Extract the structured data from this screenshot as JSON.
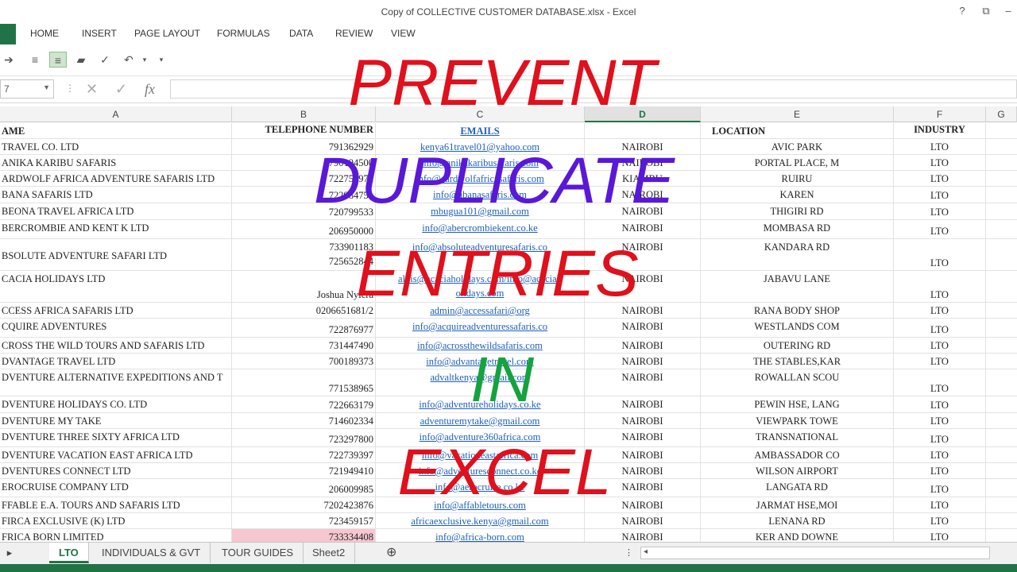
{
  "window": {
    "title": "Copy of COLLECTIVE CUSTOMER DATABASE.xlsx - Excel",
    "help_glyph": "?",
    "restore_glyph": "⧉"
  },
  "ribbon": {
    "tabs": [
      "HOME",
      "INSERT",
      "PAGE LAYOUT",
      "FORMULAS",
      "DATA",
      "REVIEW",
      "VIEW"
    ]
  },
  "formula_bar": {
    "name_box": "7",
    "fx_label": "fx",
    "content": ""
  },
  "columns": [
    "A",
    "B",
    "C",
    "D",
    "E",
    "F",
    "G"
  ],
  "selected_column": "D",
  "header_row": {
    "name": "AME",
    "phone": "TELEPHONE NUMBER",
    "email": "EMAILS",
    "town": "",
    "location": "LOCATION",
    "industry": "INDUSTRY"
  },
  "rows": [
    {
      "name": " TRAVEL CO. LTD",
      "phone": "791362929",
      "email": "kenya61travel01@yahoo.com",
      "town": "NAIROBI",
      "location": "AVIC PARK",
      "industry": "LTO"
    },
    {
      "name": "ANIKA KARIBU SAFARIS",
      "phone": "790194500",
      "email": "info@anikakaribusafaris.com",
      "town": "NAIROBI",
      "location": "PORTAL PLACE, M",
      "industry": "LTO"
    },
    {
      "name": "ARDWOLF AFRICA ADVENTURE SAFARIS LTD",
      "phone": "722751972",
      "email": "info@aardwolfafricasafaris.com",
      "town": "KIAMBU",
      "location": "RUIRU",
      "industry": "LTO"
    },
    {
      "name": "BANA SAFARIS LTD",
      "phone": "722984751",
      "email": "info@abanasafaris.com",
      "town": "NAIROBI",
      "location": "KAREN",
      "industry": "LTO"
    },
    {
      "name": "BEONA TRAVEL AFRICA LTD",
      "phone": "720799533",
      "email": "mbugua101@gmail.com",
      "town": "NAIROBI",
      "location": "THIGIRI RD",
      "industry": "LTO"
    },
    {
      "name": "BERCROMBIE AND KENT K LTD",
      "phone": "206950000",
      "email": "info@abercrombiekent.co.ke",
      "town": "NAIROBI",
      "location": "MOMBASA RD",
      "industry": "LTO"
    },
    {
      "name": "BSOLUTE ADVENTURE SAFARI LTD",
      "phone": "733901183",
      "phone2": "725652844",
      "email": "info@absoluteadventuresafaris.co",
      "town": "NAIROBI",
      "location": "KANDARA RD",
      "industry": "LTO"
    },
    {
      "name": "CACIA HOLIDAYS LTD",
      "phone": "Joshua Nyiera",
      "email": "alois@acaciaholidays.com/info@acaciah",
      "email2": "olidays.com",
      "town": "NAIROBI",
      "location": "JABAVU LANE",
      "industry": "LTO"
    },
    {
      "name": "CCESS AFRICA SAFARIS LTD",
      "phone": "0206651681/2",
      "email": "admin@accessafari@org",
      "town": "NAIROBI",
      "location": "RANA BODY SHOP",
      "industry": "LTO"
    },
    {
      "name": "CQUIRE ADVENTURES",
      "phone": "722876977",
      "email": "info@acquireadventuressafaris.co",
      "town": "NAIROBI",
      "location": "WESTLANDS COM",
      "industry": "LTO"
    },
    {
      "name": "CROSS THE WILD TOURS AND SAFARIS LTD",
      "phone": "731447490",
      "email": "info@acrossthewildsafaris.com",
      "town": "NAIROBI",
      "location": "OUTERING RD",
      "industry": "LTO"
    },
    {
      "name": "DVANTAGE TRAVEL LTD",
      "phone": "700189373",
      "email": "info@advantagetravel.com",
      "town": "NAIROBI",
      "location": "THE STABLES,KAR",
      "industry": "LTO"
    },
    {
      "name": "DVENTURE ALTERNATIVE EXPEDITIONS AND T",
      "phone": "771538965",
      "email": "advaltkenya@gmail.com",
      "town": "NAIROBI",
      "location": "ROWALLAN SCOU",
      "industry": "LTO"
    },
    {
      "name": "DVENTURE HOLIDAYS CO. LTD",
      "phone": "722663179",
      "email": "info@adventureholidays.co.ke",
      "town": "NAIROBI",
      "location": "PEWIN HSE, LANG",
      "industry": "LTO"
    },
    {
      "name": "DVENTURE MY TAKE",
      "phone": "714602334",
      "email": "adventuremytake@gmail.com",
      "town": "NAIROBI",
      "location": "VIEWPARK TOWE",
      "industry": "LTO"
    },
    {
      "name": "DVENTURE THREE SIXTY AFRICA LTD",
      "phone": "723297800",
      "email": "info@adventure360africa.com",
      "town": "NAIROBI",
      "location": "TRANSNATIONAL",
      "industry": "LTO"
    },
    {
      "name": "DVENTURE VACATION EAST AFRICA LTD",
      "phone": "722739397",
      "email": "info@vacationeastafrica.com",
      "town": "NAIROBI",
      "location": "AMBASSADOR CO",
      "industry": "LTO"
    },
    {
      "name": "DVENTURES CONNECT LTD",
      "phone": "721949410",
      "email": "info@adventuresconnect.co.ke",
      "town": "NAIROBI",
      "location": "WILSON AIRPORT",
      "industry": "LTO"
    },
    {
      "name": "EROCRUISE COMPANY LTD",
      "phone": "206009985",
      "email": "info@aerocruise.co.ke",
      "town": "NAIROBI",
      "location": "LANGATA RD",
      "industry": "LTO"
    },
    {
      "name": "FFABLE E.A. TOURS AND SAFARIS LTD",
      "phone": "7202423876",
      "email": "info@affabletours.com",
      "town": "NAIROBI",
      "location": "JARMAT HSE,MOI",
      "industry": "LTO"
    },
    {
      "name": "FIRCA EXCLUSIVE (K) LTD",
      "phone": "723459157",
      "email": "africaexclusive.kenya@gmail.com",
      "town": "NAIROBI",
      "location": "LENANA RD",
      "industry": "LTO"
    },
    {
      "name": "FRICA BORN LIMITED",
      "phone": "733334408",
      "email": "info@africa-born.com",
      "town": "NAIROBI",
      "location": "KER AND DOWNE",
      "industry": "LTO"
    }
  ],
  "overlay": {
    "line1": "PREVENT",
    "line2": "DUPLICATE",
    "line3": "ENTRIES",
    "line4": "IN",
    "line5": "EXCEL",
    "colors": {
      "line1": "#e0101c",
      "line2": "#5a18d8",
      "line3": "#e0101c",
      "line4": "#14a33c",
      "line5": "#e0101c"
    }
  },
  "sheets": [
    "LTO",
    "INDIVIDUALS & GVT",
    "TOUR GUIDES",
    "Sheet2"
  ],
  "active_sheet": "LTO",
  "add_sheet_glyph": "⊕",
  "accent_color": "#217346"
}
